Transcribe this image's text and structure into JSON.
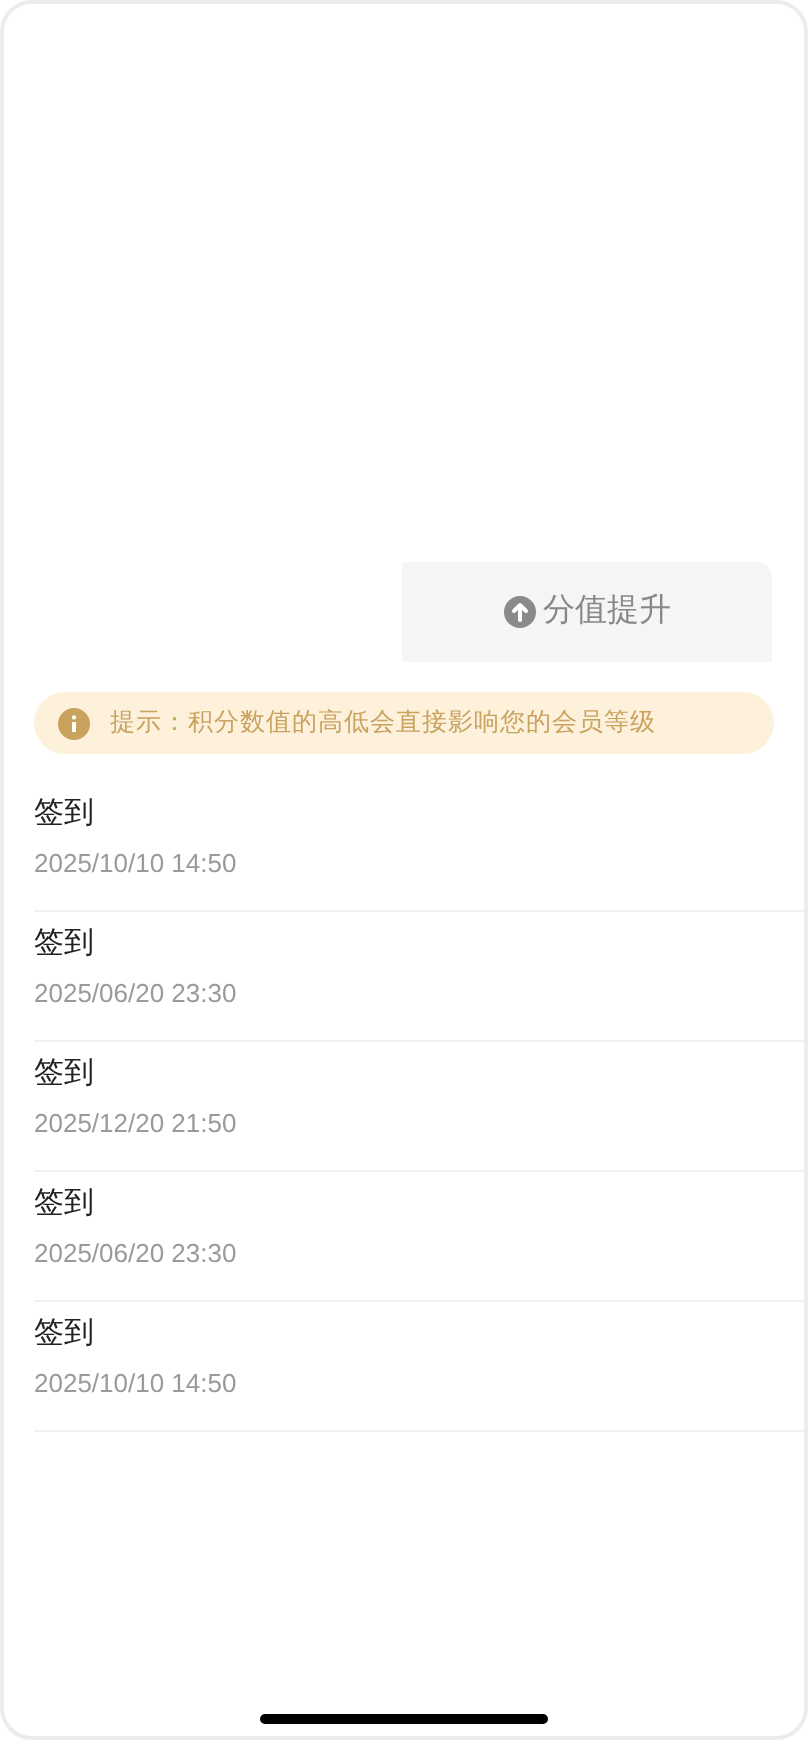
{
  "upgrade_button": {
    "label": "分值提升"
  },
  "notice": {
    "text": "提示：积分数值的高低会直接影响您的会员等级"
  },
  "records": [
    {
      "title": "签到",
      "time": "2025/10/10 14:50"
    },
    {
      "title": "签到",
      "time": "2025/06/20 23:30"
    },
    {
      "title": "签到",
      "time": "2025/12/20 21:50"
    },
    {
      "title": "签到",
      "time": "2025/06/20 23:30"
    },
    {
      "title": "签到",
      "time": "2025/10/10 14:50"
    }
  ]
}
